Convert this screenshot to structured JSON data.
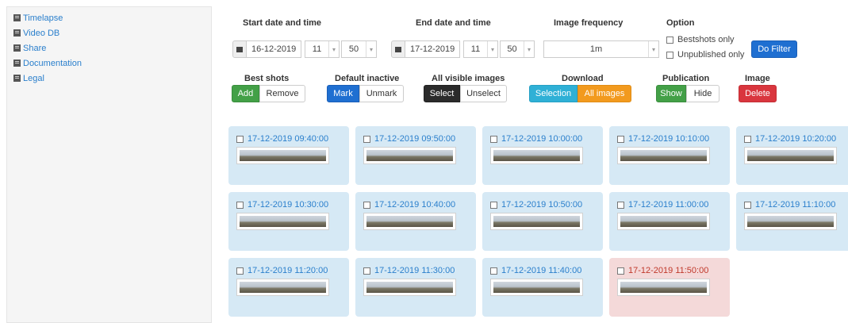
{
  "sidebar": {
    "items": [
      {
        "label": "Timelapse",
        "icon": "list-icon"
      },
      {
        "label": "Video DB",
        "icon": "list-icon"
      },
      {
        "label": "Share",
        "icon": "list-icon"
      },
      {
        "label": "Documentation",
        "icon": "list-icon"
      },
      {
        "label": "Legal",
        "icon": "list-icon"
      }
    ]
  },
  "filter": {
    "start_label": "Start date and time",
    "end_label": "End date and time",
    "frequency_label": "Image frequency",
    "option_label": "Option",
    "start_date": "16-12-2019",
    "start_hour": "11",
    "start_minute": "50",
    "end_date": "17-12-2019",
    "end_hour": "11",
    "end_minute": "50",
    "frequency": "1m",
    "option_bestshots": "Bestshots only",
    "option_unpublished": "Unpublished only",
    "do_filter": "Do Filter"
  },
  "actions": {
    "best_shots": {
      "label": "Best shots",
      "add": "Add",
      "remove": "Remove"
    },
    "default_inactive": {
      "label": "Default inactive",
      "mark": "Mark",
      "unmark": "Unmark"
    },
    "all_visible": {
      "label": "All visible images",
      "select": "Select",
      "unselect": "Unselect"
    },
    "download": {
      "label": "Download",
      "selection": "Selection",
      "all": "All images"
    },
    "publication": {
      "label": "Publication",
      "show": "Show",
      "hide": "Hide"
    },
    "image": {
      "label": "Image",
      "delete": "Delete"
    }
  },
  "images": [
    {
      "ts": "17-12-2019 09:40:00",
      "status": "normal"
    },
    {
      "ts": "17-12-2019 09:50:00",
      "status": "normal"
    },
    {
      "ts": "17-12-2019 10:00:00",
      "status": "normal"
    },
    {
      "ts": "17-12-2019 10:10:00",
      "status": "normal"
    },
    {
      "ts": "17-12-2019 10:20:00",
      "status": "normal"
    },
    {
      "ts": "17-12-2019 10:30:00",
      "status": "normal"
    },
    {
      "ts": "17-12-2019 10:40:00",
      "status": "normal"
    },
    {
      "ts": "17-12-2019 10:50:00",
      "status": "normal"
    },
    {
      "ts": "17-12-2019 11:00:00",
      "status": "normal"
    },
    {
      "ts": "17-12-2019 11:10:00",
      "status": "normal"
    },
    {
      "ts": "17-12-2019 11:20:00",
      "status": "normal"
    },
    {
      "ts": "17-12-2019 11:30:00",
      "status": "normal"
    },
    {
      "ts": "17-12-2019 11:40:00",
      "status": "normal"
    },
    {
      "ts": "17-12-2019 11:50:00",
      "status": "unpublished"
    }
  ],
  "colors": {
    "accent": "#2a7fcc",
    "card": "#d6e9f5",
    "card_alert": "#f4d9d9"
  }
}
